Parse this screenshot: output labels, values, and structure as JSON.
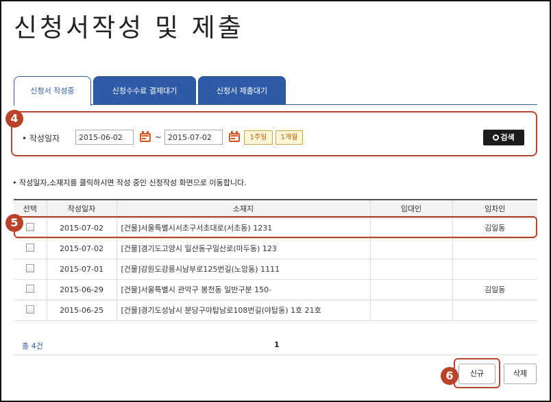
{
  "page": {
    "title": "신청서작성 및 제출"
  },
  "tabs": [
    {
      "label": "신청서 작성중",
      "active": true
    },
    {
      "label": "신청수수료 결제대기",
      "active": false
    },
    {
      "label": "신청서 제출대기",
      "active": false
    }
  ],
  "markers": {
    "search": "4",
    "row": "5",
    "new": "6"
  },
  "search": {
    "date_label": "• 작성일자",
    "start_date": "2015-06-02",
    "separator": "~",
    "end_date": "2015-07-02",
    "week_label": "1주일",
    "month_label": "1개월",
    "search_label": "검색"
  },
  "notice": "• 작성일자,소재지를 클릭하시면 작성 중인 신청작성 화면으로 이동합니다.",
  "table": {
    "headers": [
      "선택",
      "작성일자",
      "소재지",
      "임대인",
      "임차인"
    ],
    "rows": [
      {
        "date": "2015-07-02",
        "address": "[건물]서울특별시서초구서초대로(서초동) 1231",
        "landlord": "",
        "tenant": "김일동"
      },
      {
        "date": "2015-07-02",
        "address": "[건물]경기도고양시 일산동구일산로(마두동) 123",
        "landlord": "",
        "tenant": ""
      },
      {
        "date": "2015-07-01",
        "address": "[건물]강원도강릉시남부로125번길(노암동) 1111",
        "landlord": "",
        "tenant": ""
      },
      {
        "date": "2015-06-29",
        "address": "[건물]서울특별시 관악구 봉천동 일반구분 150-",
        "landlord": "",
        "tenant": "김일동"
      },
      {
        "date": "2015-06-25",
        "address": "[건물]경기도성남시 분당구야탑남로108번길(야탑동) 1호 21호",
        "landlord": "",
        "tenant": ""
      }
    ]
  },
  "footer": {
    "total": "총 4건",
    "page": "1"
  },
  "buttons": {
    "new_label": "신규",
    "delete_label": "삭제"
  },
  "colors": {
    "accent": "#2f5aa8",
    "highlight": "#b8432a",
    "calendar": "#d8501a"
  }
}
